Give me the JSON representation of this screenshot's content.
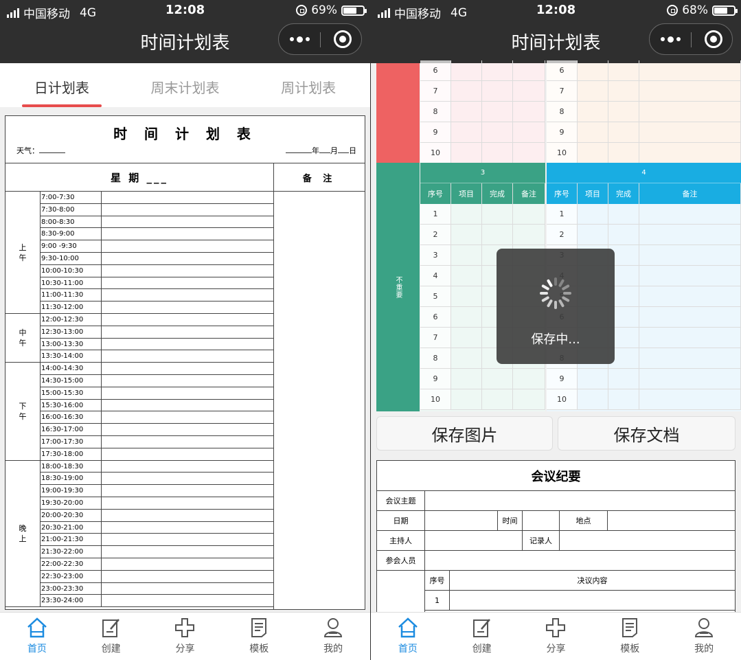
{
  "phone1": {
    "status": {
      "carrier": "中国移动",
      "network": "4G",
      "time": "12:08",
      "battery": "69%",
      "battery_level": 0.69
    },
    "nav_title": "时间计划表",
    "tabs": [
      "日计划表",
      "周末计划表",
      "周计划表"
    ],
    "paper": {
      "title": "时 间 计 划 表",
      "weather_label": "天气：",
      "date_year": "年",
      "date_month": "月",
      "date_day": "日",
      "weekday_label": "星 期 ___",
      "remark_label": "备 注",
      "periods": [
        {
          "label": "上\n午",
          "slots": [
            "7:00-7:30",
            "7:30-8:00",
            "8:00-8:30",
            "8:30-9:00",
            "9:00 -9:30",
            "9:30-10:00",
            "10:00-10:30",
            "10:30-11:00",
            "11:00-11:30",
            "11:30-12:00"
          ]
        },
        {
          "label": "中\n午",
          "slots": [
            "12:00-12:30",
            "12:30-13:00",
            "13:00-13:30",
            "13:30-14:00"
          ]
        },
        {
          "label": "下\n午",
          "slots": [
            "14:00-14:30",
            "14:30-15:00",
            "15:00-15:30",
            "15:30-16:00",
            "16:00-16:30",
            "16:30-17:00",
            "17:00-17:30",
            "17:30-18:00"
          ]
        },
        {
          "label": "晚\n上",
          "slots": [
            "18:00-18:30",
            "18:30-19:00",
            "19:00-19:30",
            "19:30-20:00",
            "20:00-20:30",
            "20:30-21:00",
            "21:00-21:30",
            "21:30-22:00",
            "22:00-22:30",
            "22:30-23:00",
            "23:00-23:30",
            "23:30-24:00"
          ]
        }
      ]
    }
  },
  "phone2": {
    "status": {
      "carrier": "中国移动",
      "network": "4G",
      "time": "12:08",
      "battery": "68%",
      "battery_level": 0.68
    },
    "nav_title": "时间计划表",
    "top_rows": [
      "6",
      "7",
      "8",
      "9",
      "10"
    ],
    "quadrant_side_label": "不重要",
    "quadrant3_title": "3",
    "quadrant4_title": "4",
    "q_headers": [
      "序号",
      "项目",
      "完成",
      "备注"
    ],
    "q_rows": [
      "1",
      "2",
      "3",
      "4",
      "5",
      "6",
      "7",
      "8",
      "9",
      "10"
    ],
    "save_image": "保存图片",
    "save_doc": "保存文档",
    "toast": "保存中...",
    "meeting": {
      "title": "会议纪要",
      "topic": "会议主题",
      "date": "日期",
      "time": "时间",
      "place": "地点",
      "host": "主持人",
      "recorder": "记录人",
      "attendees": "参会人员",
      "no": "序号",
      "content": "决议内容",
      "first_row": "1"
    }
  },
  "tabbar": [
    {
      "label": "首页",
      "icon": "home-icon"
    },
    {
      "label": "创建",
      "icon": "create-icon"
    },
    {
      "label": "分享",
      "icon": "share-icon"
    },
    {
      "label": "模板",
      "icon": "template-icon"
    },
    {
      "label": "我的",
      "icon": "profile-icon"
    }
  ],
  "colors": {
    "accent": "#e74c4c",
    "tab_active": "#1b8be0",
    "q2_red": "#ee6262",
    "q3_green": "#3aa285",
    "q4_blue": "#19ade2",
    "pink_row": "#fdeef0",
    "peach_row": "#fdf3ea",
    "green_row": "#eef8f4",
    "blue_row": "#ecf7fd"
  }
}
